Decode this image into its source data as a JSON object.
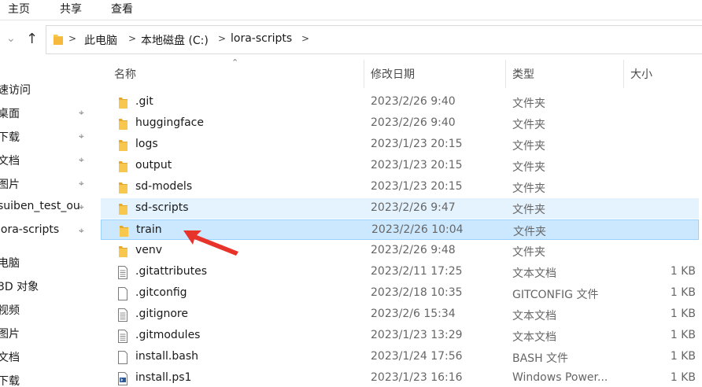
{
  "ribbon": {
    "tabs": [
      "主页",
      "共享",
      "查看"
    ]
  },
  "address": {
    "crumbs": [
      "此电脑",
      "本地磁盘 (C:)",
      "lora-scripts"
    ]
  },
  "nav_pane": {
    "items": [
      {
        "label": "速访问",
        "pinned": false
      },
      {
        "label": "桌面",
        "pinned": true
      },
      {
        "label": "下载",
        "pinned": true
      },
      {
        "label": "文档",
        "pinned": true
      },
      {
        "label": "图片",
        "pinned": true
      },
      {
        "label": "suiben_test_ou",
        "pinned": true
      },
      {
        "label": "lora-scripts",
        "pinned": true
      },
      {
        "label": "电脑",
        "pinned": false
      },
      {
        "label": "3D 对象",
        "pinned": false
      },
      {
        "label": "视频",
        "pinned": false
      },
      {
        "label": "图片",
        "pinned": false
      },
      {
        "label": "文档",
        "pinned": false
      },
      {
        "label": "下载",
        "pinned": false
      }
    ]
  },
  "columns": {
    "name": "名称",
    "date": "修改日期",
    "type": "类型",
    "size": "大小"
  },
  "files": [
    {
      "name": ".git",
      "date": "2023/2/26 9:40",
      "type": "文件夹",
      "size": "",
      "icon": "folder-icon",
      "state": ""
    },
    {
      "name": "huggingface",
      "date": "2023/2/26 9:40",
      "type": "文件夹",
      "size": "",
      "icon": "folder-icon",
      "state": ""
    },
    {
      "name": "logs",
      "date": "2023/1/23 20:15",
      "type": "文件夹",
      "size": "",
      "icon": "folder-icon",
      "state": ""
    },
    {
      "name": "output",
      "date": "2023/1/23 20:15",
      "type": "文件夹",
      "size": "",
      "icon": "folder-icon",
      "state": ""
    },
    {
      "name": "sd-models",
      "date": "2023/1/23 20:15",
      "type": "文件夹",
      "size": "",
      "icon": "folder-icon",
      "state": ""
    },
    {
      "name": "sd-scripts",
      "date": "2023/2/26 9:47",
      "type": "文件夹",
      "size": "",
      "icon": "folder-icon",
      "state": "hover"
    },
    {
      "name": "train",
      "date": "2023/2/26 10:04",
      "type": "文件夹",
      "size": "",
      "icon": "folder-icon",
      "state": "selected"
    },
    {
      "name": "venv",
      "date": "2023/2/26 9:48",
      "type": "文件夹",
      "size": "",
      "icon": "folder-icon",
      "state": ""
    },
    {
      "name": ".gitattributes",
      "date": "2023/2/11 17:25",
      "type": "文本文档",
      "size": "1 KB",
      "icon": "text-file-icon",
      "state": ""
    },
    {
      "name": ".gitconfig",
      "date": "2023/2/18 10:35",
      "type": "GITCONFIG 文件",
      "size": "1 KB",
      "icon": "blank-file-icon",
      "state": ""
    },
    {
      "name": ".gitignore",
      "date": "2023/2/6 15:34",
      "type": "文本文档",
      "size": "1 KB",
      "icon": "text-file-icon",
      "state": ""
    },
    {
      "name": ".gitmodules",
      "date": "2023/1/23 13:29",
      "type": "文本文档",
      "size": "1 KB",
      "icon": "text-file-icon",
      "state": ""
    },
    {
      "name": "install.bash",
      "date": "2023/1/24 17:56",
      "type": "BASH 文件",
      "size": "1 KB",
      "icon": "blank-file-icon",
      "state": ""
    },
    {
      "name": "install.ps1",
      "date": "2023/1/23 16:16",
      "type": "Windows Power...",
      "size": "1 KB",
      "icon": "powershell-file-icon",
      "state": ""
    }
  ],
  "colors": {
    "folder": "#f8c84e",
    "selected_bg": "#cce8ff",
    "hover_bg": "#e5f3ff",
    "arrow": "#e8332a"
  }
}
